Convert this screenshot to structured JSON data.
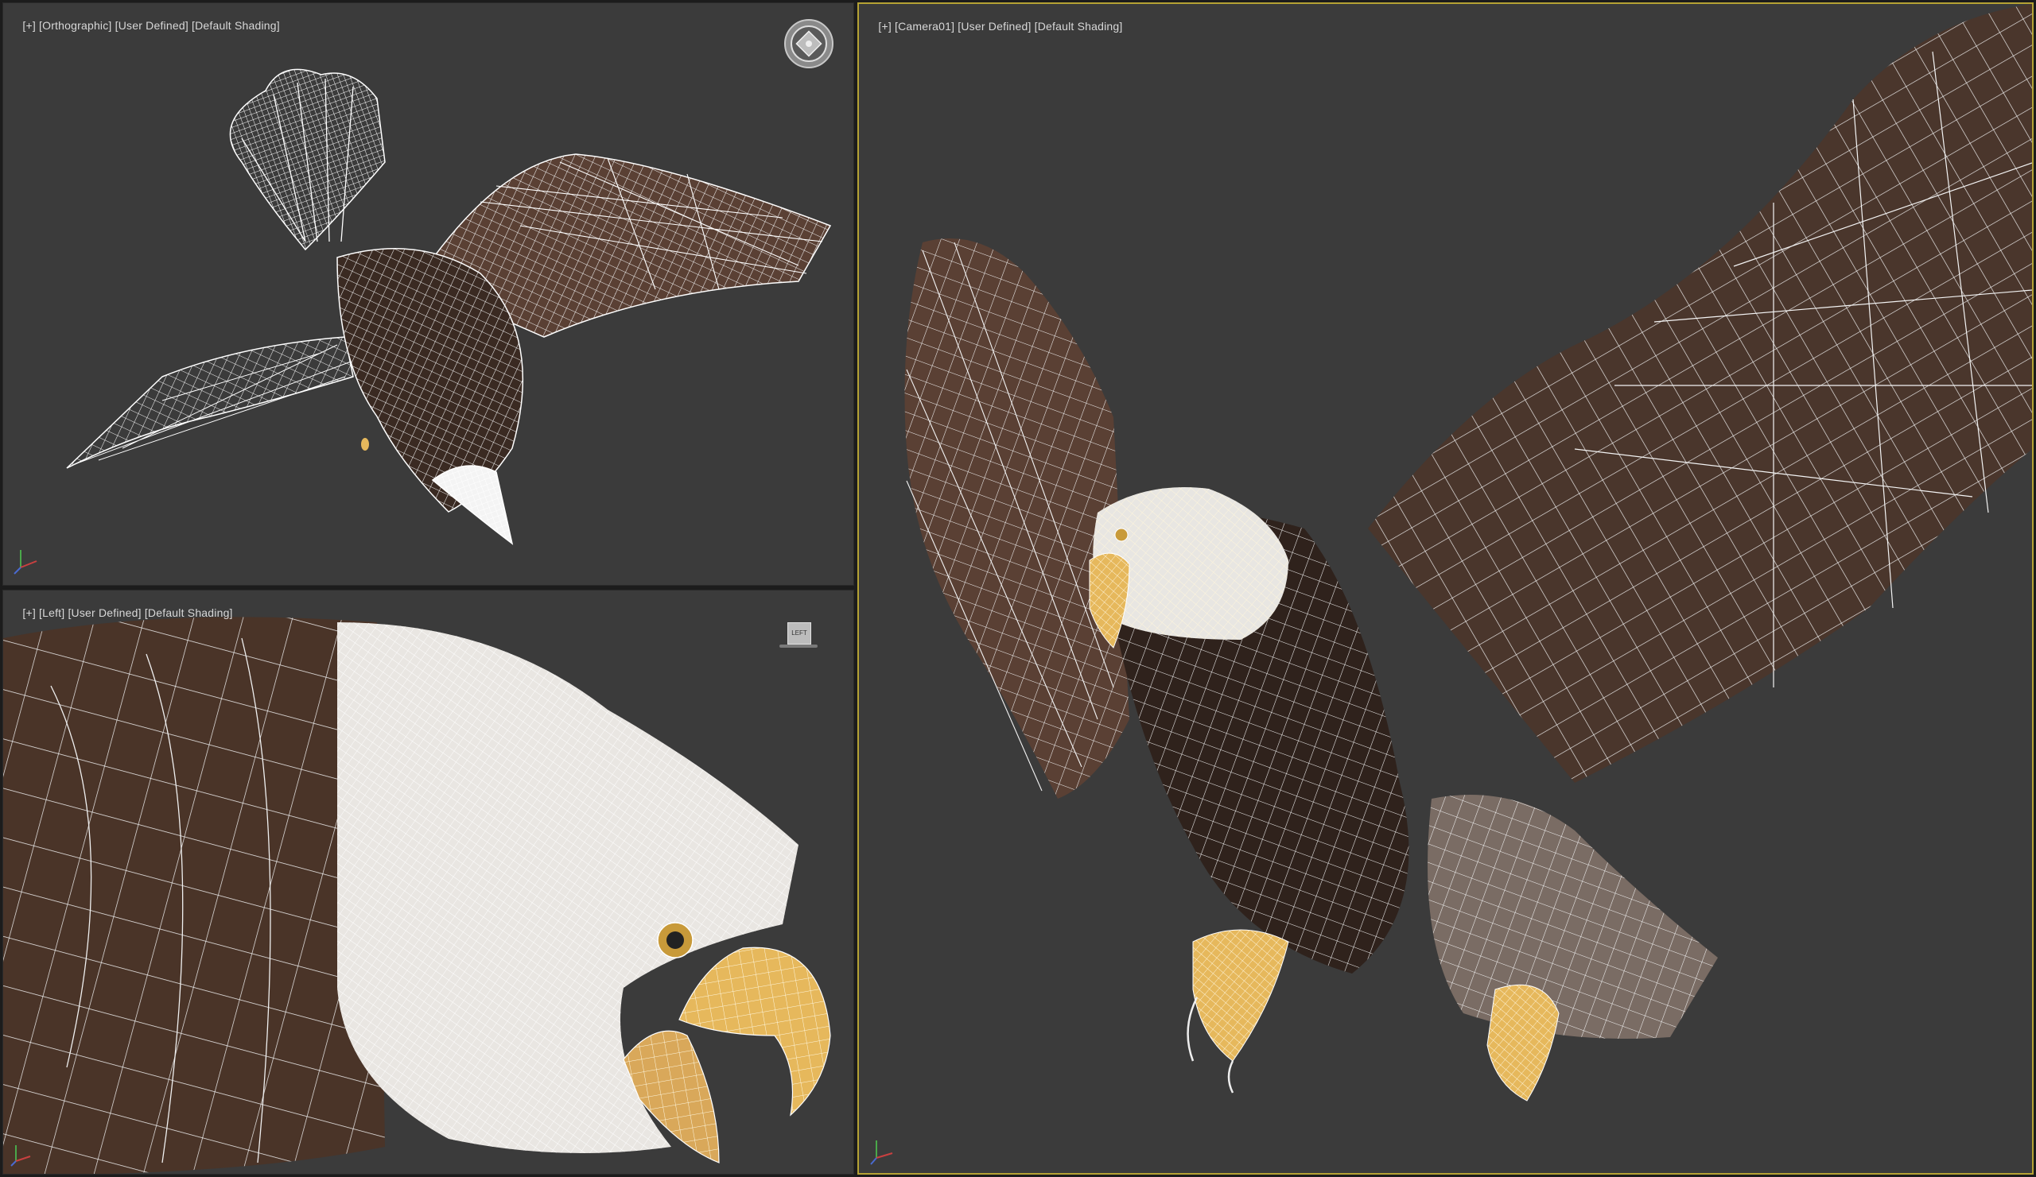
{
  "viewports": {
    "top_left": {
      "menu": "[+]",
      "view": "[Orthographic]",
      "camera_mode": "[User Defined]",
      "shading": "[Default Shading]"
    },
    "bottom_left": {
      "menu": "[+]",
      "view": "[Left]",
      "camera_mode": "[User Defined]",
      "shading": "[Default Shading]",
      "viewcube_label": "LEFT"
    },
    "right": {
      "menu": "[+]",
      "view": "[Camera01]",
      "camera_mode": "[User Defined]",
      "shading": "[Default Shading]",
      "active": true
    }
  },
  "colors": {
    "viewport_bg": "#3b3b3b",
    "active_border": "#b5a234",
    "wire": "#f2f2f2",
    "feather_dark": "#3a2a22",
    "feather_mid": "#5a4034",
    "beak": "#e6b85c"
  },
  "icons": {
    "viewcube_tl": "steering-wheel-icon",
    "viewcube_bl": "viewcube-icon",
    "axis_gizmo": "axis-tripod-icon"
  }
}
